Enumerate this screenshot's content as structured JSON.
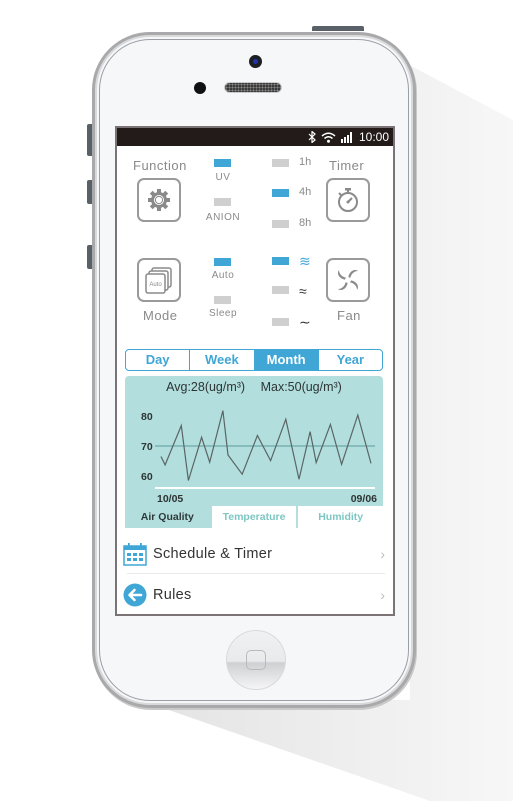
{
  "status_bar": {
    "time": "10:00",
    "icons": [
      "bluetooth-icon",
      "wifi-icon",
      "signal-icon"
    ]
  },
  "controls": {
    "function": {
      "label": "Function",
      "icon": "gear-icon",
      "options": [
        {
          "label": "UV",
          "active": true
        },
        {
          "label": "ANION",
          "active": false
        }
      ]
    },
    "timer": {
      "label": "Timer",
      "icon": "stopwatch-icon",
      "options": [
        {
          "label": "1h",
          "active": false
        },
        {
          "label": "4h",
          "active": true
        },
        {
          "label": "8h",
          "active": false
        }
      ]
    },
    "mode": {
      "label": "Mode",
      "icon": "auto-mode-icon",
      "icon_text": "Auto",
      "options": [
        {
          "label": "Auto",
          "active": true
        },
        {
          "label": "Sleep",
          "active": false
        }
      ]
    },
    "fan": {
      "label": "Fan",
      "icon": "fan-icon",
      "options": [
        {
          "label": "≋",
          "level": "high",
          "active": true
        },
        {
          "label": "≈",
          "level": "medium",
          "active": false
        },
        {
          "label": "∼",
          "level": "low",
          "active": false
        }
      ]
    }
  },
  "period_tabs": [
    {
      "label": "Day",
      "active": false
    },
    {
      "label": "Week",
      "active": false
    },
    {
      "label": "Month",
      "active": true
    },
    {
      "label": "Year",
      "active": false
    }
  ],
  "stats": {
    "avg": "Avg:28(ug/m³)",
    "max": "Max:50(ug/m³)"
  },
  "metric_tabs": [
    {
      "label": "Air Quality",
      "active": true
    },
    {
      "label": "Temperature",
      "active": false
    },
    {
      "label": "Humidity",
      "active": false
    }
  ],
  "chart_data": {
    "type": "line",
    "title": "",
    "xlabel": "",
    "ylabel": "",
    "x_start_label": "10/05",
    "x_end_label": "09/06",
    "yticks": [
      60,
      70,
      80
    ],
    "ylim": [
      57,
      83
    ],
    "reference_line": 70,
    "grid": false,
    "series": [
      {
        "name": "Air Quality",
        "values": [
          66.5,
          63.7,
          76.8,
          58.5,
          72.9,
          64.6,
          81.8,
          67.0,
          60.6,
          73.5,
          65.1,
          78.9,
          58.9,
          74.8,
          64.5,
          77.2,
          63.9,
          80.3,
          64.2
        ]
      }
    ],
    "x_positions": [
      0,
      0.4,
      2.0,
      2.7,
      4.0,
      4.8,
      6.1,
      6.6,
      8.0,
      9.5,
      10.8,
      12.3,
      13.6,
      14.7,
      15.3,
      16.7,
      17.8,
      19.4,
      20.7
    ],
    "line_color": "#5a6565",
    "reference_color": "#5b9c9a"
  },
  "menu": [
    {
      "label": "Schedule & Timer",
      "icon": "calendar-icon"
    },
    {
      "label": "Rules",
      "icon": "back-arrow-icon"
    }
  ],
  "colors": {
    "accent": "#3fa6d6",
    "chart_bg": "#b2dedd",
    "inactive_switch": "#cfcfcf",
    "status_bar": "#231a1a"
  }
}
